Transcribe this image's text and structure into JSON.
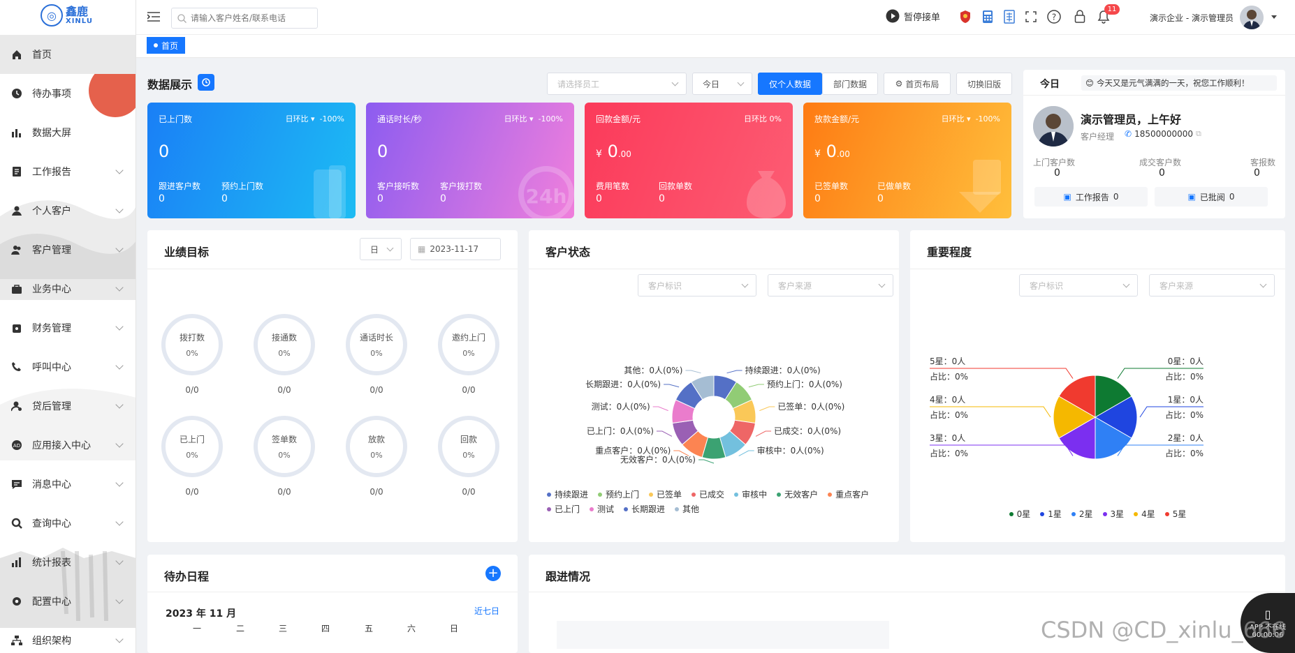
{
  "app": {
    "logo_cn": "鑫鹿",
    "logo_en": "XINLU"
  },
  "sidebar": {
    "items": [
      {
        "label": "首页",
        "icon": "home-icon",
        "active": true,
        "expandable": false
      },
      {
        "label": "待办事项",
        "icon": "clock-icon",
        "expandable": false
      },
      {
        "label": "数据大屏",
        "icon": "bar-chart-icon",
        "expandable": false
      },
      {
        "label": "工作报告",
        "icon": "report-icon",
        "expandable": true
      },
      {
        "label": "个人客户",
        "icon": "user-icon",
        "expandable": true
      },
      {
        "label": "客户管理",
        "icon": "users-icon",
        "expandable": true
      },
      {
        "label": "业务中心",
        "icon": "briefcase-icon",
        "expandable": true
      },
      {
        "label": "财务管理",
        "icon": "wallet-icon",
        "expandable": true
      },
      {
        "label": "呼叫中心",
        "icon": "phone-icon",
        "expandable": true
      },
      {
        "label": "贷后管理",
        "icon": "user-settings-icon",
        "expandable": true
      },
      {
        "label": "应用接入中心",
        "icon": "app-icon",
        "expandable": true
      },
      {
        "label": "消息中心",
        "icon": "message-icon",
        "expandable": true
      },
      {
        "label": "查询中心",
        "icon": "search-icon",
        "expandable": true
      },
      {
        "label": "统计报表",
        "icon": "stats-icon",
        "expandable": true
      },
      {
        "label": "配置中心",
        "icon": "gear-icon",
        "expandable": true
      },
      {
        "label": "组织架构",
        "icon": "org-icon",
        "expandable": true
      }
    ]
  },
  "topbar": {
    "search_placeholder": "请输入客户姓名/联系电话",
    "pause_label": "暂停接单",
    "notification_count": "11",
    "user_label": "演示企业 - 演示管理员"
  },
  "tabs": {
    "home": "首页"
  },
  "dashboard": {
    "title": "数据展示",
    "employee_placeholder": "请选择员工",
    "period": "今日",
    "btn_personal": "仅个人数据",
    "btn_dept": "部门数据",
    "btn_layout": "首页布局",
    "btn_old": "切换旧版"
  },
  "stats": [
    {
      "label": "已上门数",
      "compare": "日环比",
      "compare_val": "-100%",
      "value": "0",
      "sub1_label": "跟进客户数",
      "sub1_val": "0",
      "sub2_label": "预约上门数",
      "sub2_val": "0"
    },
    {
      "label": "通话时长/秒",
      "compare": "日环比",
      "compare_val": "-100%",
      "value": "0",
      "sub1_label": "客户接听数",
      "sub1_val": "0",
      "sub2_label": "客户拨打数",
      "sub2_val": "0"
    },
    {
      "label": "回款金额/元",
      "compare": "日环比",
      "compare_val": "0%",
      "value_prefix": "¥",
      "value": "0",
      "value_dec": ".00",
      "sub1_label": "费用笔数",
      "sub1_val": "0",
      "sub2_label": "回款单数",
      "sub2_val": "0"
    },
    {
      "label": "放款金额/元",
      "compare": "日环比",
      "compare_val": "-100%",
      "value_prefix": "¥",
      "value": "0",
      "value_dec": ".00",
      "sub1_label": "已签单数",
      "sub1_val": "0",
      "sub2_label": "已做单数",
      "sub2_val": "0"
    }
  ],
  "today": {
    "tab": "今日",
    "greeting_banner": "今天又是元气满满的一天，祝您工作顺利！",
    "user_greeting": "演示管理员，上午好",
    "role": "客户经理",
    "phone": "18500000000",
    "metrics": [
      {
        "label": "上门客户数",
        "value": "0"
      },
      {
        "label": "成交客户数",
        "value": "0"
      },
      {
        "label": "客报数",
        "value": "0"
      }
    ],
    "work_report_label": "工作报告",
    "work_report_val": "0",
    "approved_label": "已批阅",
    "approved_val": "0"
  },
  "targets": {
    "title": "业绩目标",
    "unit": "日",
    "date": "2023-11-17",
    "rings": [
      {
        "label": "拨打数",
        "percent": "0%",
        "ratio": "0/0"
      },
      {
        "label": "接通数",
        "percent": "0%",
        "ratio": "0/0"
      },
      {
        "label": "通话时长",
        "percent": "0%",
        "ratio": "0/0"
      },
      {
        "label": "邀约上门",
        "percent": "0%",
        "ratio": "0/0"
      },
      {
        "label": "已上门",
        "percent": "0%",
        "ratio": "0/0"
      },
      {
        "label": "签单数",
        "percent": "0%",
        "ratio": "0/0"
      },
      {
        "label": "放款",
        "percent": "0%",
        "ratio": "0/0"
      },
      {
        "label": "回款",
        "percent": "0%",
        "ratio": "0/0"
      }
    ]
  },
  "customer_status": {
    "title": "客户状态",
    "filter1": "客户标识",
    "filter2": "客户来源"
  },
  "importance": {
    "title": "重要程度",
    "filter1": "客户标识",
    "filter2": "客户来源"
  },
  "schedule": {
    "title": "待办日程",
    "month": "2023 年 11 月",
    "recent": "近七日",
    "weekdays": [
      "一",
      "二",
      "三",
      "四",
      "五",
      "六",
      "日"
    ]
  },
  "followup": {
    "title": "跟进情况"
  },
  "app_badge": {
    "line1": "APP 不在线",
    "line2": "00:00:06"
  },
  "watermark": "CSDN @CD_xinlu_666",
  "chart_data": [
    {
      "type": "pie",
      "title": "客户状态",
      "categories": [
        "持续跟进",
        "预约上门",
        "已签单",
        "已成交",
        "审核中",
        "无效客户",
        "重点客户",
        "已上门",
        "测试",
        "长期跟进",
        "其他"
      ],
      "values": [
        0,
        0,
        0,
        0,
        0,
        0,
        0,
        0,
        0,
        0,
        0
      ],
      "slice_labels": [
        "持续跟进：0人(0%)",
        "预约上门：0人(0%)",
        "已签单：0人(0%)",
        "已成交：0人(0%)",
        "审核中：0人(0%)",
        "无效客户：0人(0%)",
        "重点客户：0人(0%)",
        "已上门：0人(0%)",
        "测试：0人(0%)",
        "长期跟进：0人(0%)",
        "其他：0人(0%)"
      ],
      "colors": [
        "#5470c6",
        "#91cc75",
        "#fac858",
        "#ee6666",
        "#73c0de",
        "#3ba272",
        "#fc8452",
        "#9a60b4",
        "#ea7ccc",
        "#5470c6",
        "#a5bdd3"
      ],
      "donut": true,
      "legend": "bottom"
    },
    {
      "type": "pie",
      "title": "重要程度",
      "categories": [
        "0星",
        "1星",
        "2星",
        "3星",
        "4星",
        "5星"
      ],
      "values": [
        0,
        0,
        0,
        0,
        0,
        0
      ],
      "label_counts": [
        "0星：0人",
        "1星：0人",
        "2星：0人",
        "3星：0人",
        "4星：0人",
        "5星：0人"
      ],
      "label_ratios": [
        "占比：0%",
        "占比：0%",
        "占比：0%",
        "占比：0%",
        "占比：0%",
        "占比：0%"
      ],
      "colors": [
        "#0e7a32",
        "#1f45e0",
        "#2f80f5",
        "#7b2ff0",
        "#f5b800",
        "#f03a2f"
      ],
      "donut": false,
      "legend": "bottom"
    }
  ]
}
